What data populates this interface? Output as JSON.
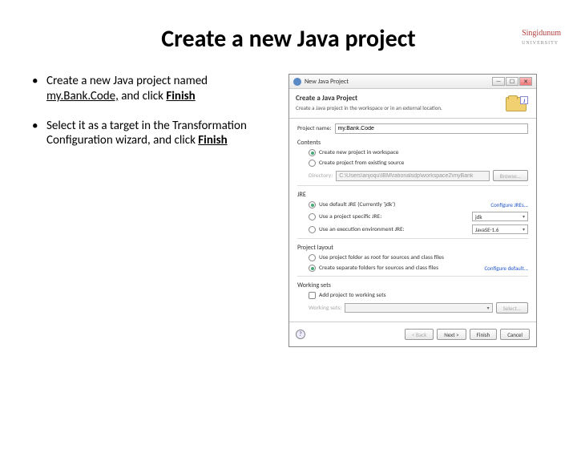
{
  "brand": {
    "name": "Singidunum",
    "sub": "UNIVERSITY"
  },
  "slide": {
    "title": "Create a new Java project",
    "bullet1a": "Create a new Java project named ",
    "bullet1b": "my.Bank.Code,",
    "bullet1c": " and click ",
    "bullet1d": "Finish",
    "bullet2a": "Select it as a target in the Transformation Configuration wizard, and click ",
    "bullet2b": "Finish"
  },
  "dialog": {
    "titlebar": "New Java Project",
    "header_title": "Create a Java Project",
    "header_sub": "Create a Java project in the workspace or in an external location.",
    "j_badge": "J",
    "project_name_label": "Project name:",
    "project_name_value": "my.Bank.Code",
    "contents": {
      "title": "Contents",
      "opt1": "Create new project in workspace",
      "opt2": "Create project from existing source",
      "dir_label": "Directory:",
      "dir_value": "C:\\Users\\anjoqu\\IBM\\rationalsdp\\workspace2\\myBank",
      "browse": "Browse..."
    },
    "jre": {
      "title": "JRE",
      "opt1a": "Use default JRE (Currently '",
      "opt1b": "jdk",
      "opt1c": "')",
      "opt2": "Use a project specific JRE:",
      "opt2_val": "jdk",
      "opt3": "Use an execution environment JRE:",
      "opt3_val": "JavaSE-1.6",
      "configure": "Configure JREs..."
    },
    "layout": {
      "title": "Project layout",
      "opt1": "Use project folder as root for sources and class files",
      "opt2": "Create separate folders for sources and class files",
      "configure": "Configure default..."
    },
    "ws": {
      "title": "Working sets",
      "check": "Add project to working sets",
      "label": "Working sets:",
      "select": "Select..."
    },
    "buttons": {
      "help": "?",
      "back": "< Back",
      "next": "Next >",
      "finish": "Finish",
      "cancel": "Cancel"
    }
  }
}
